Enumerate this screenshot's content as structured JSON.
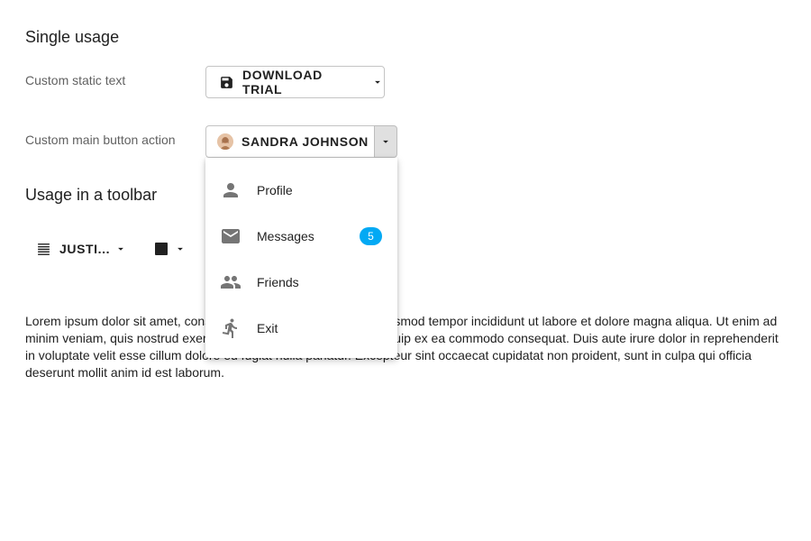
{
  "sections": {
    "single_usage_title": "Single usage",
    "toolbar_title": "Usage in a toolbar"
  },
  "static_row": {
    "label": "Custom static text",
    "button_label": "DOWNLOAD TRIAL",
    "button_icon": "save-icon"
  },
  "action_row": {
    "label": "Custom main button action",
    "button_label": "SANDRA JOHNSON",
    "avatar": "user-avatar"
  },
  "menu": {
    "items": [
      {
        "label": "Profile",
        "icon": "person-icon"
      },
      {
        "label": "Messages",
        "icon": "mail-icon",
        "badge": "5"
      },
      {
        "label": "Friends",
        "icon": "people-icon"
      },
      {
        "label": "Exit",
        "icon": "run-icon"
      }
    ]
  },
  "toolbar": {
    "align_label": "JUSTI...",
    "align_icon": "align-justify-icon",
    "color_icon": "square-icon"
  },
  "paragraph": "Lorem ipsum dolor sit amet, consectetur adipiscing elit, sed do eiusmod tempor incididunt ut labore et dolore magna aliqua. Ut enim ad minim veniam, quis nostrud exercitation ullamco laboris nisi ut aliquip ex ea commodo consequat. Duis aute irure dolor in reprehenderit in voluptate velit esse cillum dolore eu fugiat nulla pariatur. Excepteur sint occaecat cupidatat non proident, sunt in culpa qui officia deserunt mollit anim id est laborum.",
  "colors": {
    "badge": "#03a9f4",
    "icon": "#757575",
    "text": "#212121"
  }
}
